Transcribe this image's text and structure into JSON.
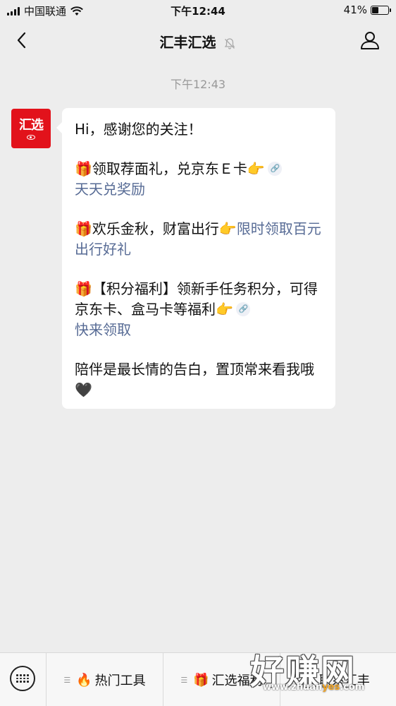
{
  "status_bar": {
    "carrier": "中国联通",
    "time": "下午12:44",
    "battery_percent": "41%",
    "battery_level": 0.41
  },
  "header": {
    "title": "汇丰汇选",
    "icons": [
      "back-arrow-icon",
      "mute-bell-icon",
      "profile-icon"
    ]
  },
  "chat": {
    "timestamp": "下午12:43",
    "avatar_text": "汇选",
    "message": {
      "greeting": "Hi，感谢您的关注！",
      "p1_gift": "🎁",
      "p1_text": "领取荐面礼，兑京东Ｅ卡",
      "p1_point": "👉",
      "p1_link": "天天兑奖励",
      "p2_gift": "🎁",
      "p2_text": "欢乐金秋，财富出行",
      "p2_point": "👉",
      "p2_link": "限时领取百元出行好礼",
      "p3_gift": "🎁",
      "p3_text": "【积分福利】领新手任务积分，可得京东卡、盒马卡等福利",
      "p3_point": "👉",
      "p3_link": "快来领取",
      "closing": "陪伴是最长情的告白，置顶常来看我哦",
      "closing_heart": "🖤"
    }
  },
  "bottom_menu": {
    "items": [
      {
        "icon": "🔥",
        "label": "热门工具"
      },
      {
        "icon": "🎁",
        "label": "汇选福利"
      },
      {
        "icon": "",
        "label": "联系汇丰"
      }
    ]
  },
  "watermark": {
    "big": "好赚网",
    "small_a": "www.zhuan",
    "small_b": "yes",
    "small_c": ".com"
  },
  "colors": {
    "background": "#ededed",
    "link": "#576b95",
    "avatar_bg": "#e2121b"
  }
}
